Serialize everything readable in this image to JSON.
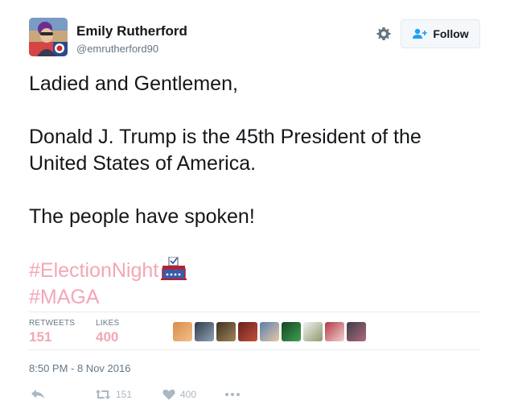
{
  "author": {
    "name": "Emily Rutherford",
    "handle": "@emrutherford90"
  },
  "follow_button": {
    "label": "Follow"
  },
  "tweet": {
    "line1": "Ladied and Gentlemen,",
    "line2": "Donald J. Trump is the 45th President of the",
    "line3": "United States of America.",
    "line4": "The people have spoken!",
    "hashtag1": "#ElectionNight",
    "hashtag2": "#MAGA"
  },
  "stats": {
    "retweets_label": "RETWEETS",
    "retweets_count": "151",
    "likes_label": "LIKES",
    "likes_count": "400"
  },
  "timestamp": "8:50 PM - 8 Nov 2016",
  "actions": {
    "retweet_count": "151",
    "like_count": "400"
  },
  "colors": {
    "hashtag": "#f4a6b6",
    "muted": "#657786",
    "icon": "#aab8c2"
  },
  "icons": [
    "gear-icon",
    "follow-user-icon",
    "ballot-box-icon",
    "reply-icon",
    "retweet-icon",
    "heart-icon",
    "more-icon"
  ]
}
